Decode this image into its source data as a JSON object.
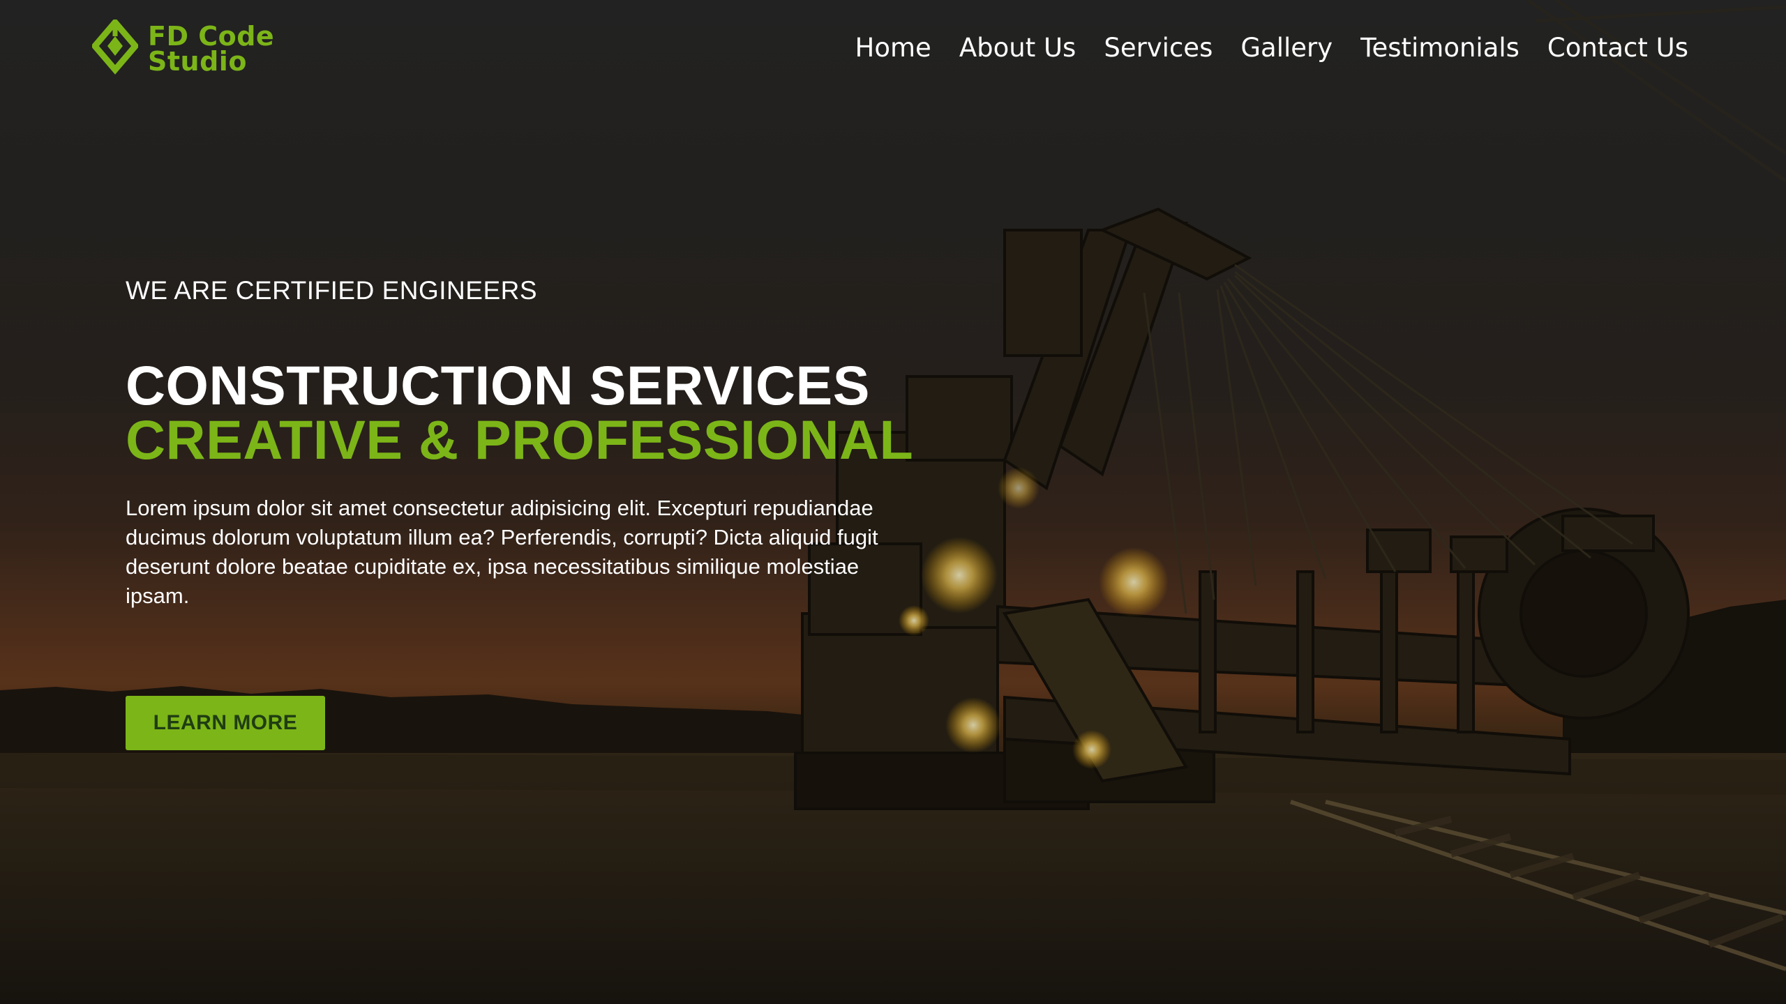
{
  "brand": {
    "name_line1": "FD Code",
    "name_line2": "Studio",
    "accent_color": "#7cb518",
    "logo_icon": "diamond-logo-icon"
  },
  "nav": {
    "items": [
      {
        "label": "Home"
      },
      {
        "label": "About Us"
      },
      {
        "label": "Services"
      },
      {
        "label": "Gallery"
      },
      {
        "label": "Testimonials"
      },
      {
        "label": "Contact Us"
      }
    ]
  },
  "hero": {
    "eyebrow": "WE ARE CERTIFIED ENGINEERS",
    "headline_line1": "CONSTRUCTION SERVICES",
    "headline_line2": "CREATIVE & PROFESSIONAL",
    "description": "Lorem ipsum dolor sit amet consectetur adipisicing elit. Excepturi repudiandae ducimus dolorum voluptatum illum ea? Perferendis, corrupti? Dicta aliquid fugit deserunt dolore beatae cupiditate ex, ipsa necessitatibus similique molestiae ipsam.",
    "cta_label": "LEARN MORE",
    "background_image": "bucket-wheel-excavator-at-dusk"
  }
}
